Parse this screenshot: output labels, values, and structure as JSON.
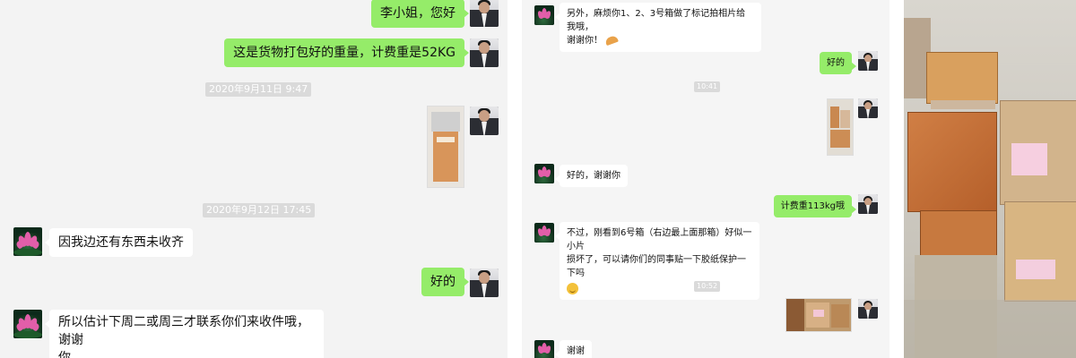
{
  "panel1": {
    "messages": [
      {
        "side": "right",
        "text": "李小姐，您好"
      },
      {
        "side": "right",
        "text": "这是货物打包好的重量，计费重是52KG"
      },
      {
        "type": "time",
        "text": "2020年9月11日 9:47"
      },
      {
        "side": "right",
        "type": "image"
      },
      {
        "type": "time",
        "text": "2020年9月12日 17:45"
      },
      {
        "side": "left",
        "text": "因我边还有东西未收齐"
      },
      {
        "side": "right",
        "text": "好的"
      },
      {
        "side": "left",
        "text": "所以估计下周二或周三才联系你们来收件哦，谢谢你"
      }
    ],
    "m1": "李小姐，您好",
    "m2": "这是货物打包好的重量，计费重是52KG",
    "t1": "2020年9月11日 9:47",
    "t2": "2020年9月12日 17:45",
    "m3": "因我边还有东西未收齐",
    "m4": "好的",
    "m5a": "所以估计下周二或周三才联系你们来收件哦，谢谢",
    "m5b": "你"
  },
  "panel2": {
    "m1a": "另外，麻烦你1、2、3号箱做了标记拍相片给我哦，",
    "m1b": "谢谢你！",
    "m2": "好的",
    "t1": "10:41",
    "m3": "好的，谢谢你",
    "m4": "计费重113kg哦",
    "m5a": "不过，刚看到6号箱（右边最上面那箱）好似一小片",
    "m5b": "损坏了，可以请你们的同事贴一下胶纸保护一下吗",
    "t2": "10:52",
    "m6": "谢谢"
  },
  "icons": {
    "self_avatar": "man-in-suit-avatar",
    "contact_avatar": "pink-lotus-avatar",
    "emoji_smile": "smile-emoji",
    "emoji_muscle": "muscle-emoji"
  },
  "colors": {
    "sent_bubble": "#95ec69",
    "received_bubble": "#ffffff",
    "chat_bg": "#f3f3f3",
    "timestamp_bg": "#dadada"
  }
}
